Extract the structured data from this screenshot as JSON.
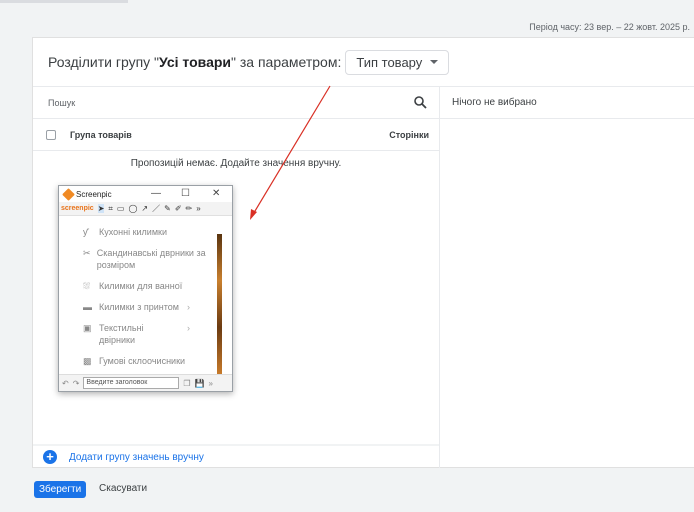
{
  "period": "Період часу: 23 вер. – 22 жовт. 2025 р.",
  "header": {
    "prefix": "Розділити групу \"",
    "group": "Усі товари",
    "suffix": "\" за параметром:",
    "dimension": "Тип товару"
  },
  "search": {
    "placeholder": "Пошук"
  },
  "table": {
    "col_group": "Група товарів",
    "col_pages": "Сторінки",
    "empty": "Пропозицій немає. Додайте значення вручну."
  },
  "add_group": "Додати групу значень вручну",
  "right": {
    "selected": "Нічого не вибрано"
  },
  "actions": {
    "save": "Зберегти",
    "cancel": "Скасувати"
  },
  "screenpic": {
    "title": "Screenpic",
    "brand": "screenpic",
    "title_placeholder": "Введите заголовок",
    "items": [
      {
        "icon": "cutlery",
        "label": "Кухонні килимки"
      },
      {
        "icon": "scissors",
        "label": "Скандинавські дврники за розміром"
      },
      {
        "icon": "bath",
        "label": "Килимки для ванної"
      },
      {
        "icon": "print",
        "label": "Килимки з принтом"
      },
      {
        "icon": "textile",
        "label": "Текстильні двірники"
      },
      {
        "icon": "rubber",
        "label": "Гумові склоочисники"
      }
    ]
  },
  "colors": {
    "accent": "#1a73e8",
    "arrow": "#d93025"
  }
}
